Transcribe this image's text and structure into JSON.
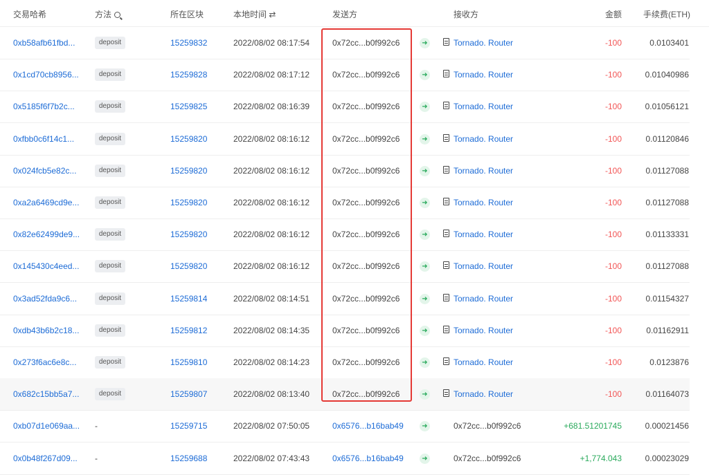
{
  "header": {
    "tx_hash": "交易哈希",
    "method": "方法",
    "block": "所在区块",
    "local_time": "本地时间",
    "local_time_icon": "⇄",
    "from": "发送方",
    "to": "接收方",
    "amount": "金额",
    "fee": "手续费(ETH)"
  },
  "colors": {
    "link": "#1c6bd6",
    "negative": "#f25454",
    "positive": "#2aaa5c",
    "highlight_box": "#e53935"
  },
  "rows": [
    {
      "hash": "0xb58afb61fbd...",
      "method": "deposit",
      "block": "15259832",
      "time": "2022/08/02 08:17:54",
      "from": "0x72cc...b0f992c6",
      "to": "Tornado. Router",
      "amount": "-100",
      "fee": "0.0103401"
    },
    {
      "hash": "0x1cd70cb8956...",
      "method": "deposit",
      "block": "15259828",
      "time": "2022/08/02 08:17:12",
      "from": "0x72cc...b0f992c6",
      "to": "Tornado. Router",
      "amount": "-100",
      "fee": "0.01040986"
    },
    {
      "hash": "0x5185f6f7b2c...",
      "method": "deposit",
      "block": "15259825",
      "time": "2022/08/02 08:16:39",
      "from": "0x72cc...b0f992c6",
      "to": "Tornado. Router",
      "amount": "-100",
      "fee": "0.01056121"
    },
    {
      "hash": "0xfbb0c6f14c1...",
      "method": "deposit",
      "block": "15259820",
      "time": "2022/08/02 08:16:12",
      "from": "0x72cc...b0f992c6",
      "to": "Tornado. Router",
      "amount": "-100",
      "fee": "0.01120846"
    },
    {
      "hash": "0x024fcb5e82c...",
      "method": "deposit",
      "block": "15259820",
      "time": "2022/08/02 08:16:12",
      "from": "0x72cc...b0f992c6",
      "to": "Tornado. Router",
      "amount": "-100",
      "fee": "0.01127088"
    },
    {
      "hash": "0xa2a6469cd9e...",
      "method": "deposit",
      "block": "15259820",
      "time": "2022/08/02 08:16:12",
      "from": "0x72cc...b0f992c6",
      "to": "Tornado. Router",
      "amount": "-100",
      "fee": "0.01127088"
    },
    {
      "hash": "0x82e62499de9...",
      "method": "deposit",
      "block": "15259820",
      "time": "2022/08/02 08:16:12",
      "from": "0x72cc...b0f992c6",
      "to": "Tornado. Router",
      "amount": "-100",
      "fee": "0.01133331"
    },
    {
      "hash": "0x145430c4eed...",
      "method": "deposit",
      "block": "15259820",
      "time": "2022/08/02 08:16:12",
      "from": "0x72cc...b0f992c6",
      "to": "Tornado. Router",
      "amount": "-100",
      "fee": "0.01127088"
    },
    {
      "hash": "0x3ad52fda9c6...",
      "method": "deposit",
      "block": "15259814",
      "time": "2022/08/02 08:14:51",
      "from": "0x72cc...b0f992c6",
      "to": "Tornado. Router",
      "amount": "-100",
      "fee": "0.01154327"
    },
    {
      "hash": "0xdb43b6b2c18...",
      "method": "deposit",
      "block": "15259812",
      "time": "2022/08/02 08:14:35",
      "from": "0x72cc...b0f992c6",
      "to": "Tornado. Router",
      "amount": "-100",
      "fee": "0.01162911"
    },
    {
      "hash": "0x273f6ac6e8c...",
      "method": "deposit",
      "block": "15259810",
      "time": "2022/08/02 08:14:23",
      "from": "0x72cc...b0f992c6",
      "to": "Tornado. Router",
      "amount": "-100",
      "fee": "0.0123876"
    },
    {
      "hash": "0x682c15bb5a7...",
      "method": "deposit",
      "block": "15259807",
      "time": "2022/08/02 08:13:40",
      "from": "0x72cc...b0f992c6",
      "to": "Tornado. Router",
      "amount": "-100",
      "fee": "0.01164073"
    },
    {
      "hash": "0xb07d1e069aa...",
      "method": "-",
      "block": "15259715",
      "time": "2022/08/02 07:50:05",
      "from": "0x6576...b16bab49",
      "to": "0x72cc...b0f992c6",
      "amount": "+681.51201745",
      "fee": "0.00021456"
    },
    {
      "hash": "0x0b48f267d09...",
      "method": "-",
      "block": "15259688",
      "time": "2022/08/02 07:43:43",
      "from": "0x6576...b16bab49",
      "to": "0x72cc...b0f992c6",
      "amount": "+1,774.043",
      "fee": "0.00023029"
    }
  ]
}
